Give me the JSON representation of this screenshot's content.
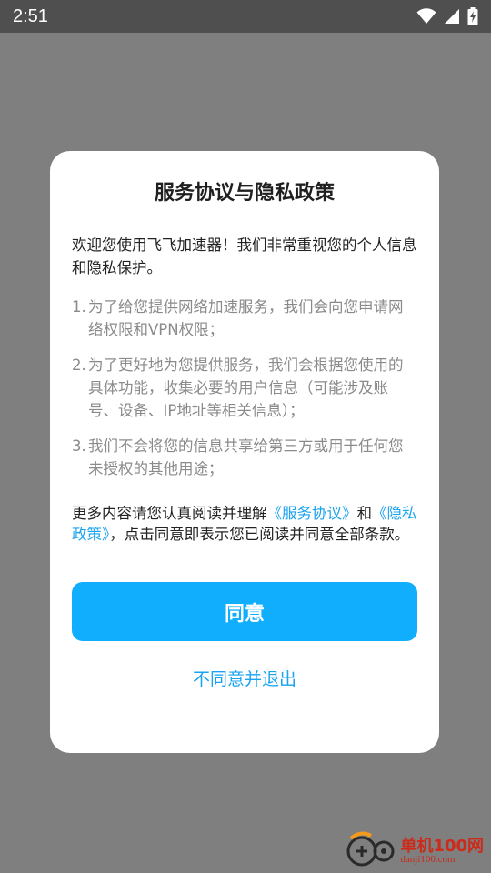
{
  "status_bar": {
    "time": "2:51",
    "icons": [
      "wifi-icon",
      "signal-icon",
      "battery-charging-icon"
    ]
  },
  "dialog": {
    "title": "服务协议与隐私政策",
    "intro": "欢迎您使用飞飞加速器！我们非常重视您的个人信息和隐私保护。",
    "terms": [
      {
        "num": "1.",
        "text": "为了给您提供网络加速服务，我们会向您申请网络权限和VPN权限；"
      },
      {
        "num": "2.",
        "text": "为了更好地为您提供服务，我们会根据您使用的具体功能，收集必要的用户信息（可能涉及账号、设备、IP地址等相关信息）；"
      },
      {
        "num": "3.",
        "text": "我们不会将您的信息共享给第三方或用于任何您未授权的其他用途；"
      }
    ],
    "more_prefix": "更多内容请您认真阅读并理解",
    "service_link": "《服务协议》",
    "more_and": "和",
    "privacy_link": "《隐私政策》",
    "more_suffix": "，点击同意即表示您已阅读并同意全部条款。",
    "agree_label": "同意",
    "decline_label": "不同意并退出"
  },
  "watermark": {
    "name": "单机100网",
    "url": "danji100.com"
  },
  "colors": {
    "accent": "#10aefc",
    "link": "#1aa3f0",
    "overlay": "#7f7f7f",
    "status_bar": "#4f4f4f"
  }
}
